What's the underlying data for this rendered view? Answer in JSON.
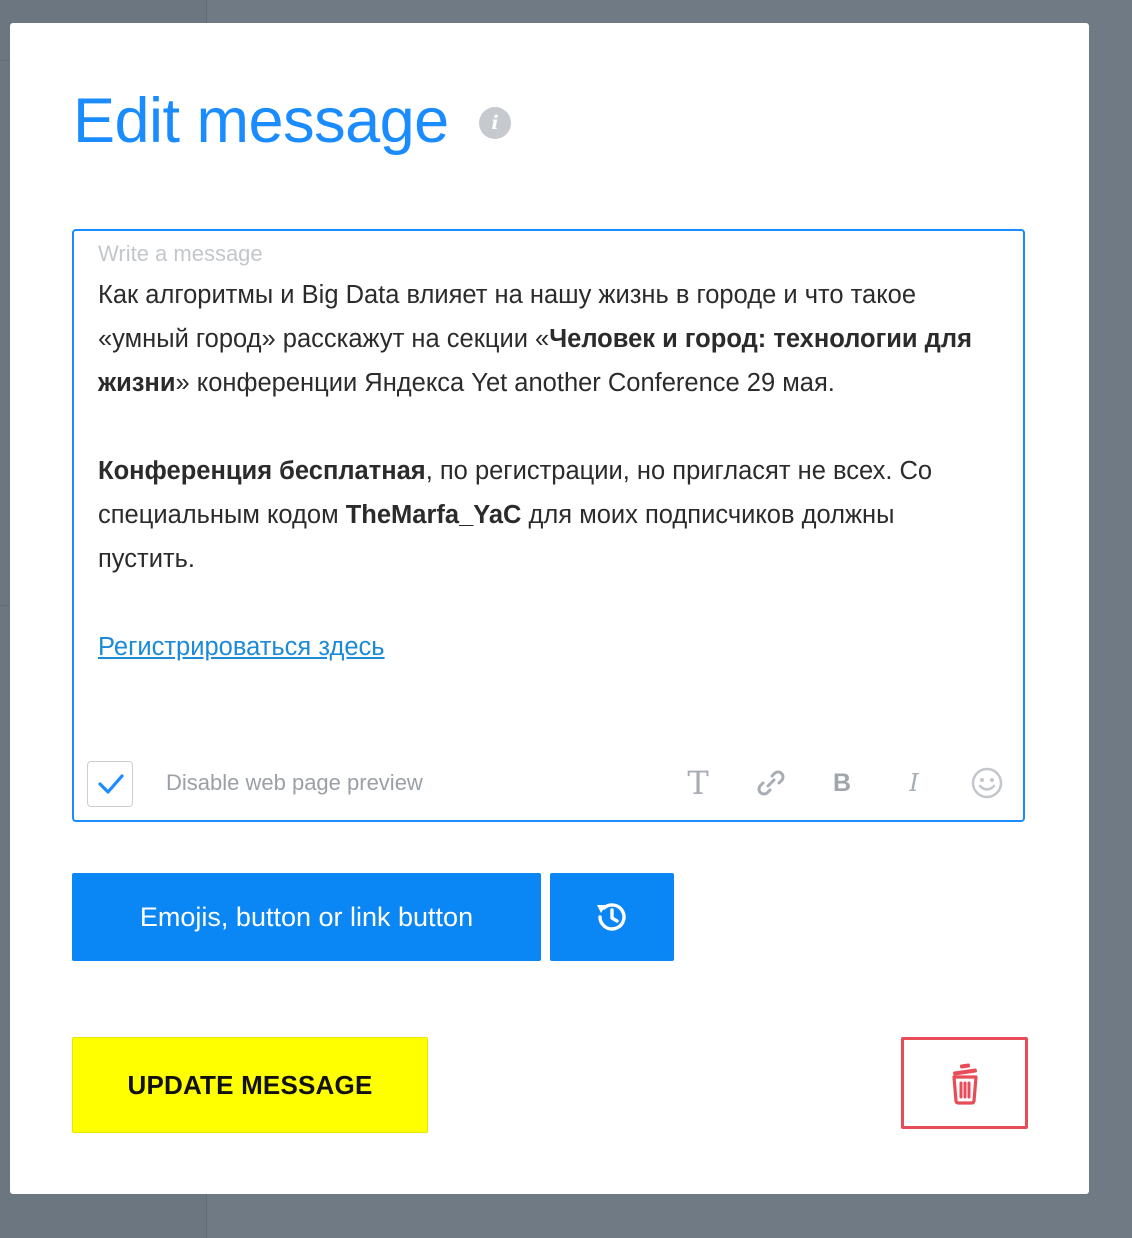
{
  "dialog": {
    "title": "Edit message",
    "info_glyph": "i"
  },
  "editor": {
    "placeholder": "Write a message",
    "p1_a": "Как алгоритмы и Big Data влияет на нашу жизнь в городе и что такое «умный город» расскажут на секции «",
    "p1_bold": "Человек и город: технологии для жизни",
    "p1_b": "» конференции Яндекса Yet another Conference 29 мая.",
    "p2_bold": "Конференция бесплатная",
    "p2_a": ", по регистрации, но пригласят не всех. Со специальным кодом ",
    "p2_code": "TheMarfa_YaC",
    "p2_b": " для моих подписчиков должны пустить.",
    "link_text": "Регистрироваться здесь"
  },
  "options": {
    "disable_preview_label": "Disable web page preview",
    "disable_preview_checked": true
  },
  "toolbar": {
    "text_glyph": "T",
    "bold_glyph": "B",
    "italic_glyph": "I",
    "icons": [
      "text-format-icon",
      "link-icon",
      "bold-icon",
      "italic-icon",
      "emoji-icon"
    ]
  },
  "buttons": {
    "emojis_label": "Emojis, button or link button",
    "history_icon": "history-icon",
    "update_label": "UPDATE MESSAGE",
    "delete_icon": "trash-icon"
  },
  "colors": {
    "accent": "#1a8cff",
    "button_blue": "#0a86f5",
    "update_bg": "#ffff00",
    "delete_border": "#e84c58",
    "overlay": "#6f7a85"
  }
}
